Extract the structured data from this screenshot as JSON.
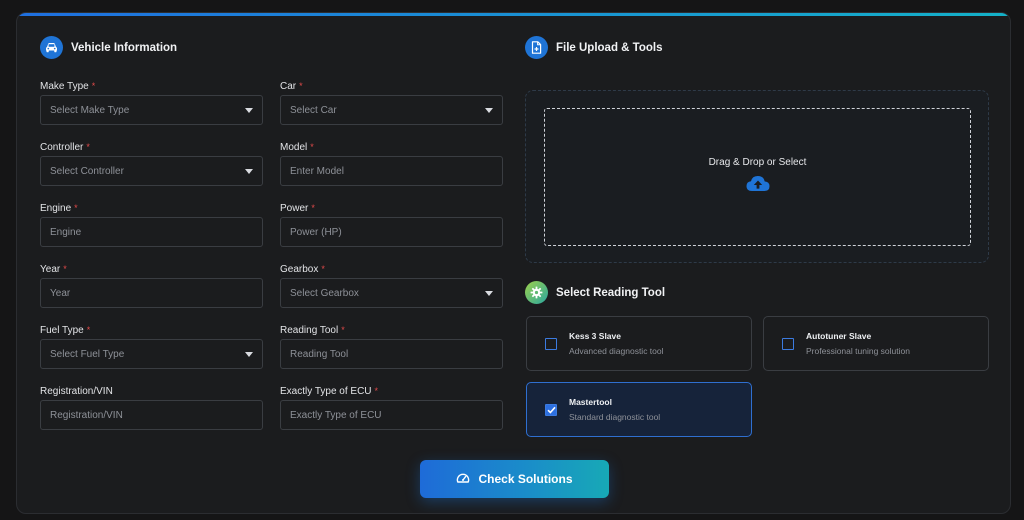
{
  "vehicle_section": {
    "title": "Vehicle Information",
    "fields": [
      {
        "label": "Make Type",
        "required": "*",
        "value": "Select Make Type"
      },
      {
        "label": "Car",
        "required": "*",
        "value": "Select Car"
      },
      {
        "label": "Controller",
        "required": "*",
        "value": "Select Controller"
      },
      {
        "label": "Model",
        "required": "*",
        "placeholder": "Enter Model"
      },
      {
        "label": "Engine",
        "required": "*",
        "placeholder": "Engine"
      },
      {
        "label": "Power",
        "required": "*",
        "placeholder": "Power (HP)"
      },
      {
        "label": "Year",
        "required": "*",
        "placeholder": "Year"
      },
      {
        "label": "Gearbox",
        "required": "*",
        "value": "Select Gearbox"
      },
      {
        "label": "Fuel Type",
        "required": "*",
        "value": "Select Fuel Type"
      },
      {
        "label": "Reading Tool",
        "required": "*",
        "placeholder": "Reading Tool"
      },
      {
        "label": "Registration/VIN",
        "placeholder": "Registration/VIN"
      },
      {
        "label": "Exactly Type of ECU",
        "required": "*",
        "placeholder": "Exactly Type of ECU"
      }
    ]
  },
  "upload_section": {
    "title": "File Upload & Tools",
    "drop_text": "Drag & Drop or Select"
  },
  "reading_tool_section": {
    "title": "Select Reading Tool",
    "tools": [
      {
        "name": "Kess 3 Slave",
        "description": "Advanced diagnostic tool",
        "checked": false
      },
      {
        "name": "Autotuner Slave",
        "description": "Professional tuning solution",
        "checked": false
      },
      {
        "name": "Mastertool",
        "description": "Standard diagnostic tool",
        "checked": true
      }
    ]
  },
  "submit": {
    "label": "Check Solutions"
  },
  "colors": {
    "accent": "#1f74d6",
    "required": "#e24a4a",
    "background": "#1b1c1e"
  }
}
